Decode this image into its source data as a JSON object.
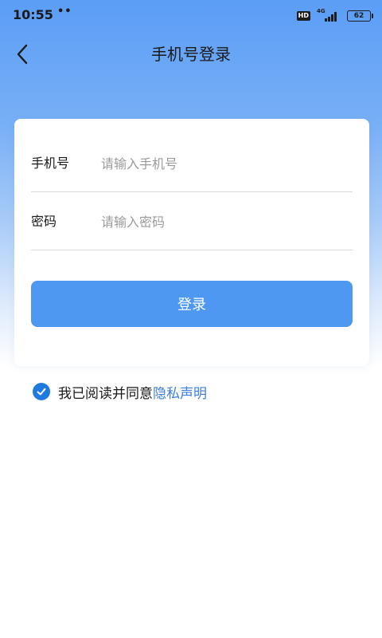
{
  "status_bar": {
    "time": "10:55",
    "dots": "••",
    "hd": "HD",
    "network": "4G",
    "battery": "62"
  },
  "nav": {
    "title": "手机号登录"
  },
  "form": {
    "phone": {
      "label": "手机号",
      "placeholder": "请输入手机号",
      "value": ""
    },
    "password": {
      "label": "密码",
      "placeholder": "请输入密码",
      "value": ""
    },
    "login_label": "登录"
  },
  "agreement": {
    "checked": true,
    "text": "我已阅读并同意",
    "link": "隐私声明"
  },
  "colors": {
    "primary_button": "#4e98f2",
    "checkbox": "#1f7ae0",
    "link": "#3b7de0",
    "header_gradient_top": "#5b9df6"
  }
}
